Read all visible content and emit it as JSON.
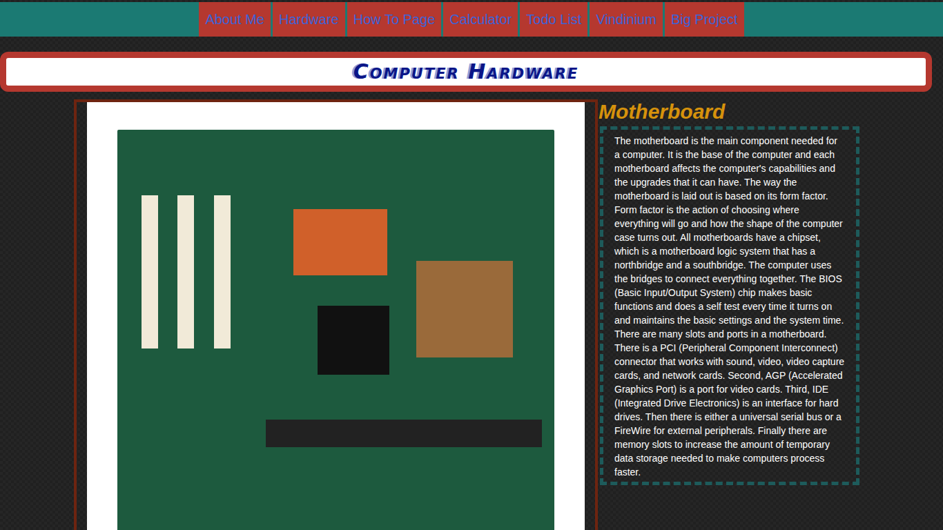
{
  "nav": {
    "items": [
      {
        "label": "About Me"
      },
      {
        "label": "Hardware"
      },
      {
        "label": "How To Page"
      },
      {
        "label": "Calculator"
      },
      {
        "label": "Todo List"
      },
      {
        "label": "Vindinium"
      },
      {
        "label": "Big Project"
      }
    ]
  },
  "header": {
    "title": "Computer Hardware"
  },
  "section": {
    "heading": "Motherboard",
    "body": "The motherboard is the main component needed for a computer. It is the base of the computer and each motherboard affects the computer's capabilities and the upgrades that it can have. The way the motherboard is laid out is based on its form factor. Form factor is the action of choosing where everything will go and how the shape of the computer case turns out. All motherboards have a chipset, which is a motherboard logic system that has a northbridge and a southbridge. The computer uses the bridges to connect everything together. The BIOS (Basic Input/Output System) chip makes basic functions and does a self test every time it turns on and maintains the basic settings and the system time. There are many slots and ports in a motherboard. There is a PCI (Peripheral Component Interconnect) connector that works with sound, video, video capture cards, and network cards. Second, AGP (Accelerated Graphics Port) is a port for video cards. Third, IDE (Integrated Drive Electronics) is an interface for hard drives. Then there is either a universal serial bus or a FireWire for external peripherals. Finally there are memory slots to increase the amount of temporary data storage needed to make computers process faster."
  }
}
